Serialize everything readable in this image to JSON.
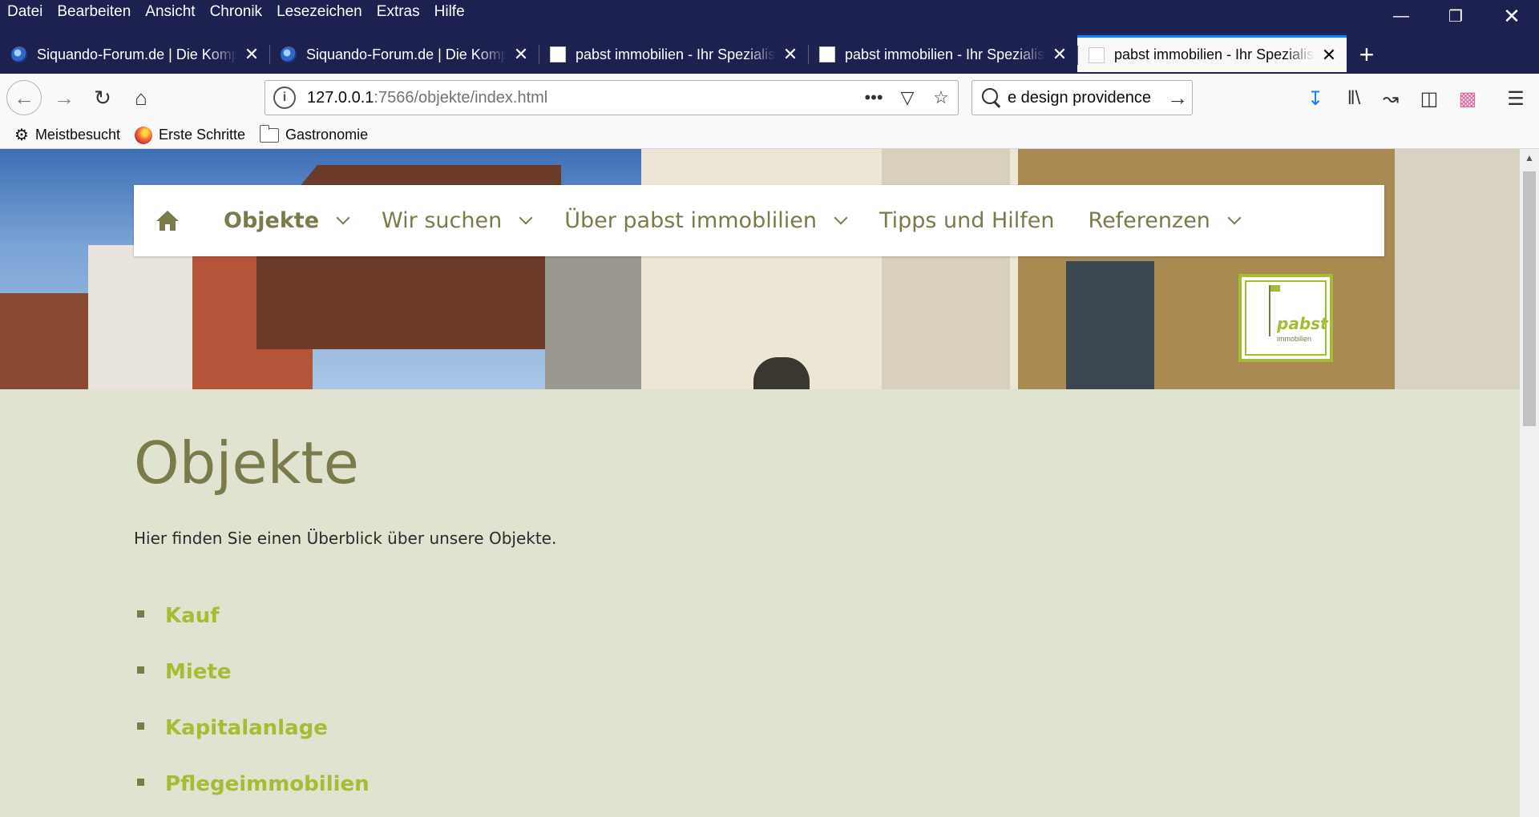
{
  "menu": [
    "Datei",
    "Bearbeiten",
    "Ansicht",
    "Chronik",
    "Lesezeichen",
    "Extras",
    "Hilfe"
  ],
  "tabs": [
    {
      "title": "Siquando-Forum.de | Die Komp",
      "favicon": "siquando-icon",
      "active": false
    },
    {
      "title": "Siquando-Forum.de | Die Komp",
      "favicon": "siquando-icon",
      "active": false
    },
    {
      "title": "pabst immobilien - Ihr Spezialis",
      "favicon": "page-icon",
      "active": false
    },
    {
      "title": "pabst immobilien - Ihr Spezialis",
      "favicon": "page-icon",
      "active": false
    },
    {
      "title": "pabst immobilien - Ihr Spezialis",
      "favicon": "page-icon",
      "active": true
    }
  ],
  "url": {
    "host": "127.0.0.1",
    "rest": ":7566/objekte/index.html"
  },
  "search": {
    "text": "e design providence"
  },
  "bookmarks": [
    "Meistbesucht",
    "Erste Schritte",
    "Gastronomie"
  ],
  "site_nav": {
    "items": [
      {
        "label": "Objekte",
        "dropdown": true,
        "active": true
      },
      {
        "label": "Wir suchen",
        "dropdown": true,
        "active": false
      },
      {
        "label": "Über pabst immoblilien",
        "dropdown": true,
        "active": false
      },
      {
        "label": "Tipps und Hilfen",
        "dropdown": false,
        "active": false
      },
      {
        "label": "Referenzen",
        "dropdown": true,
        "active": false
      }
    ]
  },
  "logo": {
    "text": "pabst",
    "sub": "immobilien"
  },
  "page": {
    "title": "Objekte",
    "intro": "Hier finden Sie einen Überblick über unsere Objekte.",
    "links": [
      "Kauf",
      "Miete",
      "Kapitalanlage",
      "Pflegeimmobilien"
    ]
  },
  "colors": {
    "accent": "#a4bd32",
    "olive": "#7a7a4a",
    "page_bg": "#dfe3cf",
    "titlebar": "#1c2150"
  }
}
